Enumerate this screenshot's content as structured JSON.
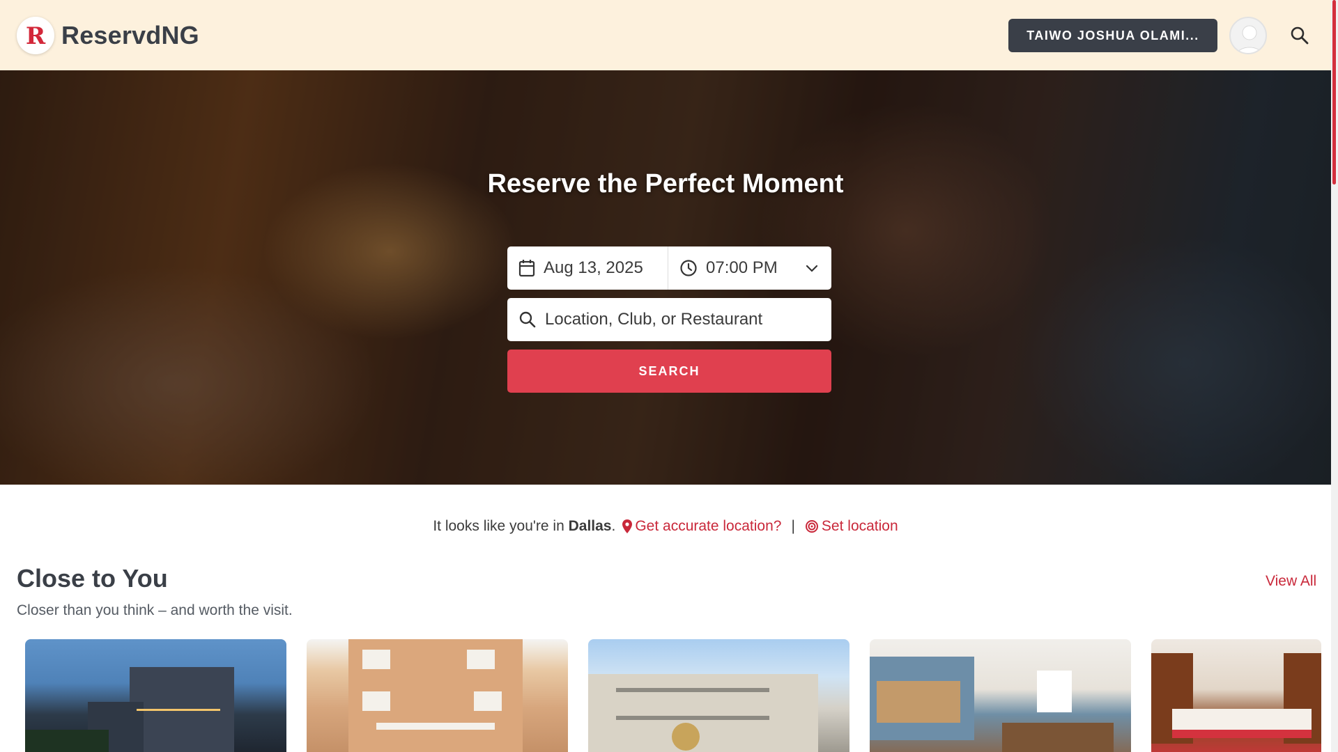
{
  "brand": {
    "logo_letter": "R",
    "name": "ReservdNG",
    "accent_color": "#d3283a"
  },
  "header": {
    "user_button_label": "TAIWO JOSHUA OLAMI...",
    "avatar_icon": "user-avatar-icon",
    "search_icon": "search-icon"
  },
  "hero": {
    "title": "Reserve the Perfect Moment",
    "date_value": "Aug 13, 2025",
    "time_value": "07:00 PM",
    "search_placeholder": "Location, Club, or Restaurant",
    "search_button_label": "SEARCH"
  },
  "location_bar": {
    "prefix": "It looks like you're in",
    "city": "Dallas",
    "suffix": ".",
    "accurate_link": "Get accurate location?",
    "separator": "|",
    "set_link": "Set location"
  },
  "section": {
    "title": "Close to You",
    "subtitle": "Closer than you think – and worth the visit.",
    "view_all": "View All",
    "cards": [
      {
        "icon": "hotel-tower-image"
      },
      {
        "icon": "guest-house-image"
      },
      {
        "icon": "apartment-building-image"
      },
      {
        "icon": "lounge-interior-image"
      },
      {
        "icon": "hotel-bedroom-image"
      }
    ]
  }
}
